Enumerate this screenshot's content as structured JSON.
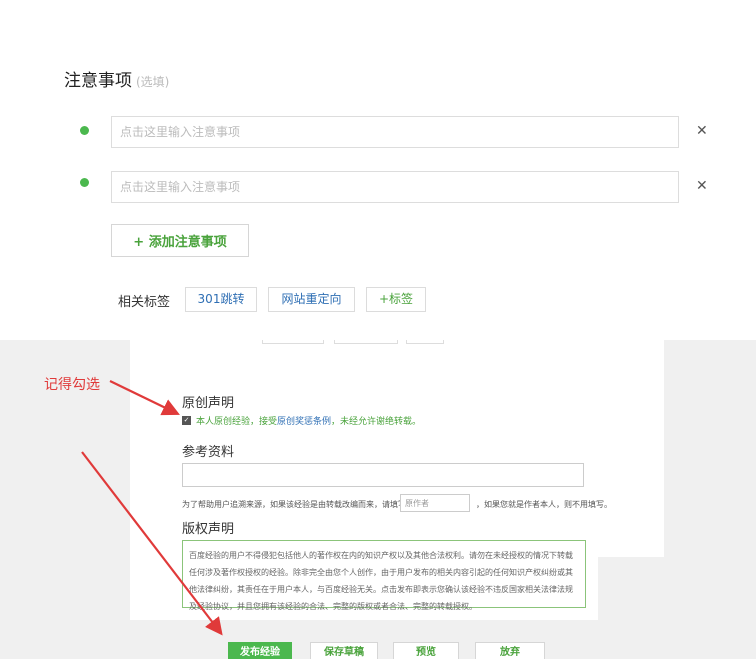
{
  "notes": {
    "title": "注意事项",
    "optional": "(选填)",
    "placeholder": "点击这里输入注意事项",
    "delete_symbol": "✕",
    "add_label": "+ 添加注意事项"
  },
  "tags": {
    "label": "相关标签",
    "items": [
      "301跳转",
      "网站重定向"
    ],
    "add_label": "+标签"
  },
  "annotation": {
    "text": "记得勾选"
  },
  "original": {
    "title": "原创声明",
    "text_before": "本人原创经验，接受",
    "link": "原创奖惩条例",
    "text_after": "，未经允许谢绝转载。"
  },
  "reference": {
    "title": "参考资料",
    "help_before": "为了帮助用户追溯来源，如果该经验是由转载改编而来，请填写",
    "author_placeholder": "原作者",
    "help_after": "，如果您就是作者本人，则不用填写。"
  },
  "copyright": {
    "title": "版权声明",
    "text": "百度经验的用户不得侵犯包括他人的著作权在内的知识产权以及其他合法权利。请勿在未经授权的情况下转载任何涉及著作权授权的经验。除非完全由您个人创作，由于用户发布的相关内容引起的任何知识产权纠纷或其他法律纠纷，其责任在于用户本人，与百度经验无关。点击发布即表示您确认该经验不违反国家相关法律法规及经验协议，并且您拥有该经验的合法、完整的版权或者合法、完整的转载授权。"
  },
  "actions": {
    "publish": "发布经验",
    "save_draft": "保存草稿",
    "preview": "预览",
    "abandon": "放弃"
  },
  "colors": {
    "accent_green": "#4bb84e",
    "link_blue": "#2f6fb4",
    "annotation_red": "#e03a3a"
  }
}
